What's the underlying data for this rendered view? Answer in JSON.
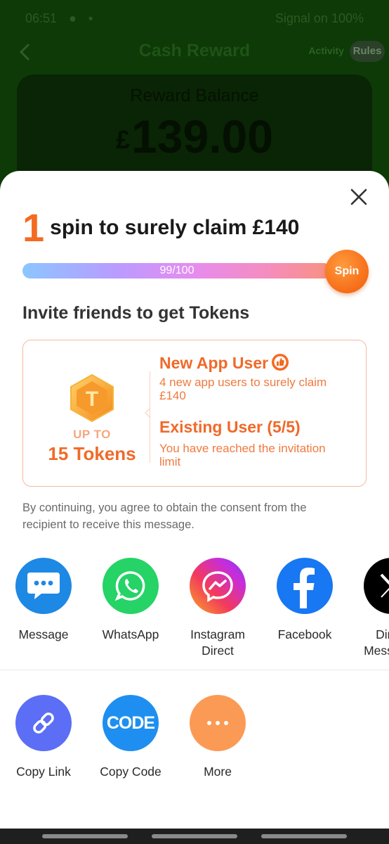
{
  "status_bar": {
    "time": "06:51",
    "signal_text": "Signal on",
    "battery": "100%"
  },
  "header": {
    "title": "Cash Reward",
    "activity": "Activity",
    "rules": "Rules"
  },
  "balance": {
    "label": "Reward Balance",
    "currency": "£",
    "amount": "139.00"
  },
  "sheet": {
    "headline_number": "1",
    "headline_text": "spin to surely claim £140",
    "progress": {
      "text": "99/100",
      "value": 99,
      "max": 100
    },
    "spin_label": "Spin",
    "invite_title": "Invite friends to get Tokens",
    "card": {
      "upto": "UP TO",
      "tokens": "15 Tokens",
      "new_user_title": "New App User",
      "new_user_desc": "4 new app users to surely claim £140",
      "existing_title": "Existing User (5/5)",
      "existing_desc": "You have reached the invitation limit"
    },
    "consent": "By continuing, you agree to obtain the consent from the recipient to receive this message.",
    "share_targets": [
      {
        "label": "Message",
        "icon": "message-icon",
        "color": "#1e88e5"
      },
      {
        "label": "WhatsApp",
        "icon": "whatsapp-icon",
        "color": "#25d366"
      },
      {
        "label": "Instagram Direct",
        "icon": "messenger-icon",
        "color": "#d62976"
      },
      {
        "label": "Facebook",
        "icon": "facebook-icon",
        "color": "#1877f2"
      },
      {
        "label": "Direct Messages",
        "icon": "x-icon",
        "color": "#000000"
      }
    ],
    "actions": [
      {
        "label": "Copy Link",
        "icon": "link-icon",
        "color": "#5b6ef5"
      },
      {
        "label": "Copy Code",
        "icon": "code-icon",
        "color": "#1e8ff0",
        "glyph": "CODE"
      },
      {
        "label": "More",
        "icon": "more-icon",
        "color": "#fb9a55"
      }
    ]
  }
}
